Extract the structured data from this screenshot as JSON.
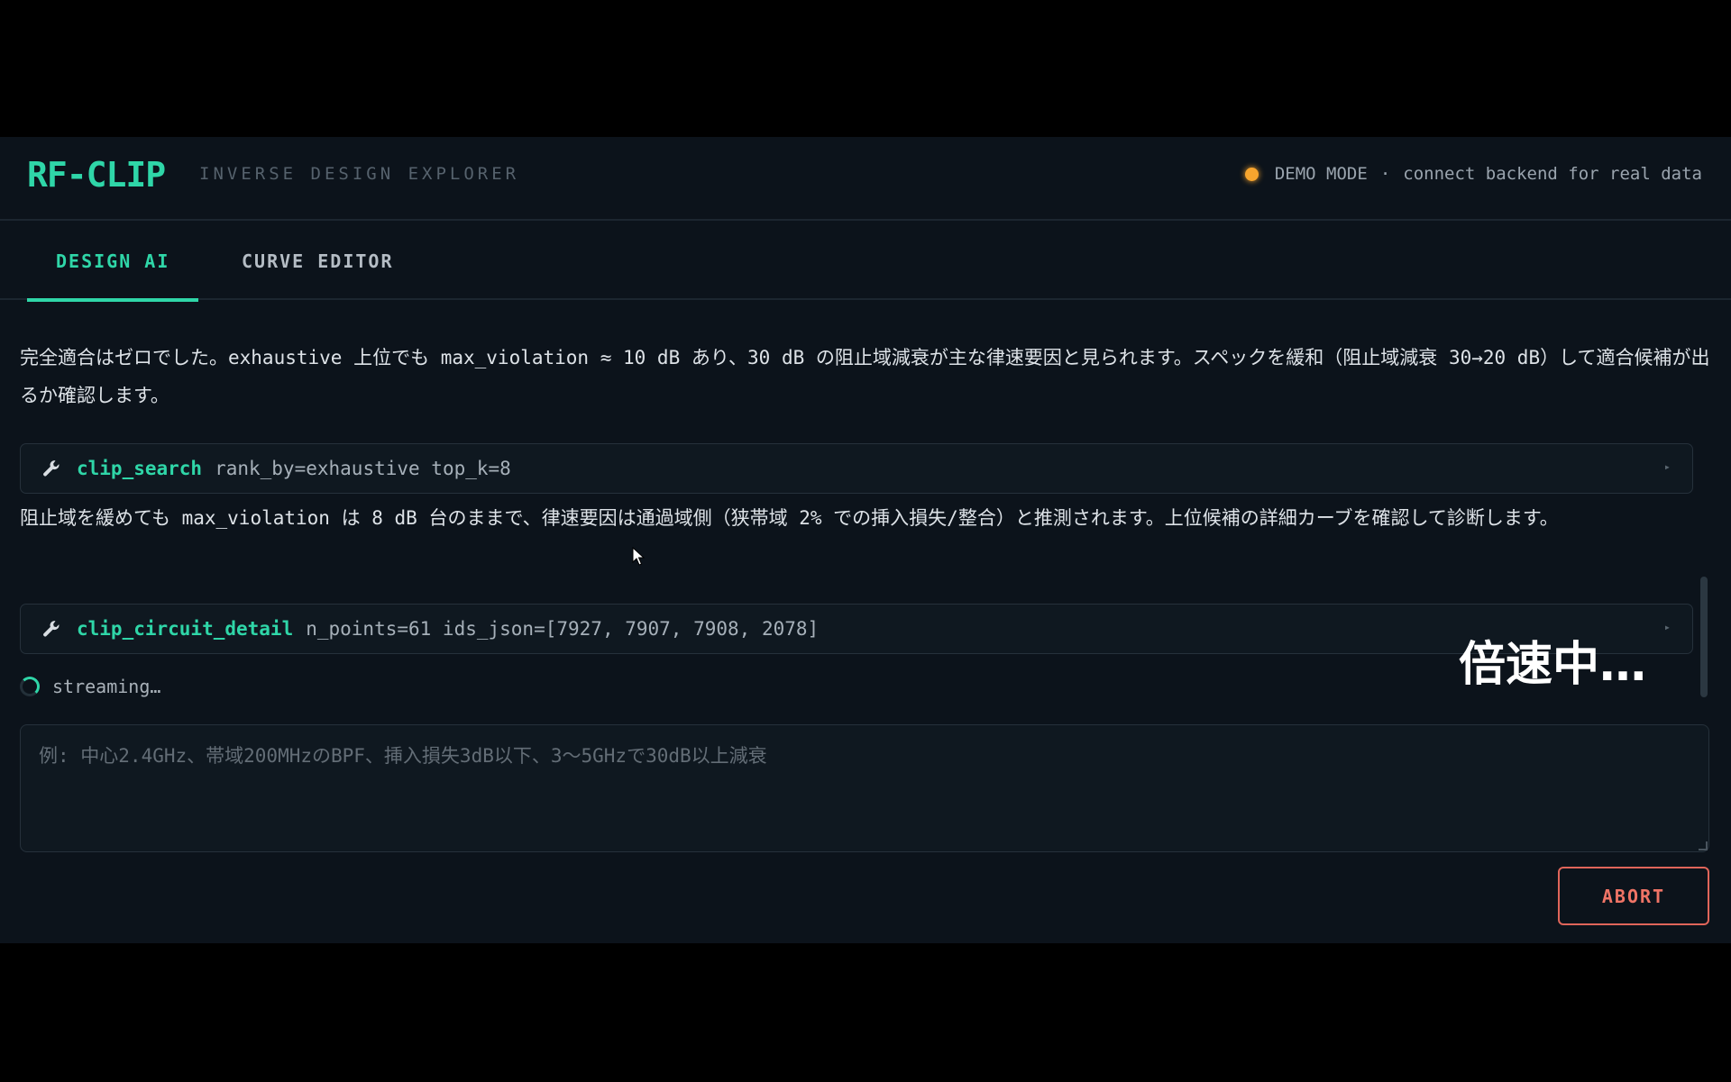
{
  "header": {
    "logo": "RF-CLIP",
    "subtitle": "INVERSE DESIGN EXPLORER",
    "status": {
      "mode": "DEMO MODE",
      "separator": "·",
      "text": "connect backend for real data",
      "dot_color": "#f7a52e"
    }
  },
  "tabs": [
    {
      "label": "DESIGN AI",
      "active": true
    },
    {
      "label": "CURVE EDITOR",
      "active": false
    }
  ],
  "chat": {
    "messages": [
      {
        "text": "完全適合はゼロでした。exhaustive 上位でも max_violation ≈ 10 dB あり、30 dB の阻止域減衰が主な律速要因と見られます。スペックを緩和（阻止域減衰 30→20 dB）して適合候補が出るか確認します。"
      },
      {
        "text": "阻止域を緩めても max_violation は 8 dB 台のままで、律速要因は通過域側（狭帯域 2% での挿入損失/整合）と推測されます。上位候補の詳細カーブを確認して診断します。"
      }
    ],
    "tool_calls": [
      {
        "name": "clip_search",
        "args": "rank_by=exhaustive top_k=8",
        "icon": "wrench-icon"
      },
      {
        "name": "clip_circuit_detail",
        "args": "n_points=61 ids_json=[7927, 7907, 7908, 2078]",
        "icon": "wrench-icon"
      }
    ],
    "streaming_label": "streaming…"
  },
  "overlay_text": "倍速中…",
  "input": {
    "placeholder": "例: 中心2.4GHz、帯域200MHzのBPF、挿入損失3dB以下、3〜5GHzで30dB以上減衰",
    "value": ""
  },
  "actions": {
    "abort_label": "ABORT"
  },
  "colors": {
    "accent": "#2fd6a8",
    "abort": "#e0655a",
    "background": "#0c131b",
    "text": "#dde2e7"
  }
}
